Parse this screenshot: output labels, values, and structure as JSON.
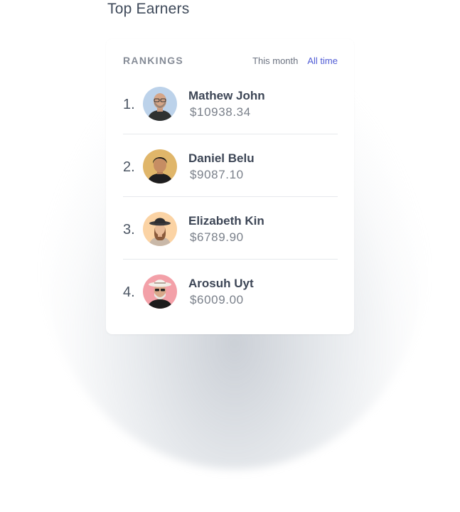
{
  "page": {
    "title": "Top Earners"
  },
  "card": {
    "header": "RANKINGS",
    "filters": {
      "this_month": "This month",
      "all_time": "All time"
    }
  },
  "earners": [
    {
      "rank": "1.",
      "name": "Mathew John",
      "amount": "$10938.34",
      "avatar_bg": "#bcd2ea"
    },
    {
      "rank": "2.",
      "name": "Daniel Belu",
      "amount": "$9087.10",
      "avatar_bg": "#e0b66a"
    },
    {
      "rank": "3.",
      "name": "Elizabeth Kin",
      "amount": "$6789.90",
      "avatar_bg": "#fbd3a4"
    },
    {
      "rank": "4.",
      "name": "Arosuh Uyt",
      "amount": "$6009.00",
      "avatar_bg": "#f3a0a8"
    }
  ],
  "colors": {
    "accent": "#4f5bd5",
    "text_dark": "#3d4656",
    "text_muted": "#7a808a"
  }
}
